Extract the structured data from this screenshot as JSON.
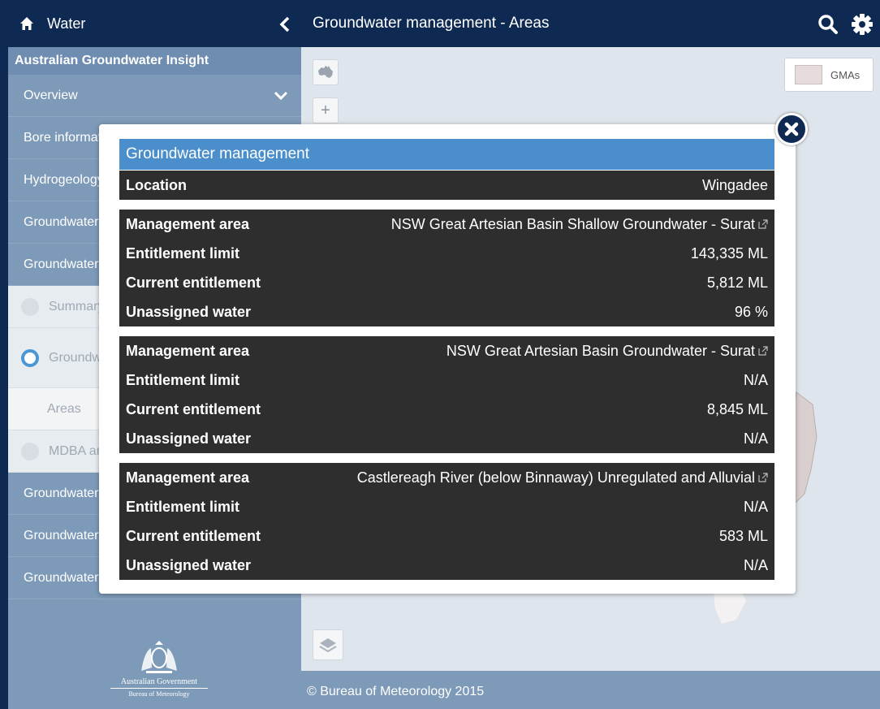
{
  "sidebar": {
    "header": "Water",
    "app_title": "Australian Groundwater Insight",
    "items": [
      {
        "label": "Overview"
      },
      {
        "label": "Bore information"
      },
      {
        "label": "Hydrogeology"
      },
      {
        "label": "Groundwater levels"
      },
      {
        "label": "Groundwater management"
      }
    ],
    "sub_items": [
      {
        "label": "Summary"
      },
      {
        "label": "Groundwater management areas"
      },
      {
        "label": "Areas"
      },
      {
        "label": "MDBA areas"
      }
    ],
    "items_after": [
      {
        "label": "Groundwater"
      },
      {
        "label": "Groundwater"
      },
      {
        "label": "Groundwater"
      }
    ],
    "logo": {
      "gov": "Australian Government",
      "bom": "Bureau of Meteorology"
    }
  },
  "topbar": {
    "title": "Groundwater management - Areas"
  },
  "map": {
    "legend_label": "GMAs",
    "zoom_in": "+"
  },
  "footer": {
    "text": "© Bureau of Meteorology 2015"
  },
  "popup": {
    "title": "Groundwater management",
    "location_label": "Location",
    "location_value": "Wingadee",
    "areas": [
      {
        "management_area_label": "Management area",
        "management_area": "NSW Great Artesian Basin Shallow Groundwater - Surat",
        "entitlement_limit_label": "Entitlement limit",
        "entitlement_limit": "143,335 ML",
        "current_entitlement_label": "Current entitlement",
        "current_entitlement": "5,812 ML",
        "unassigned_label": "Unassigned water",
        "unassigned": "96 %"
      },
      {
        "management_area_label": "Management area",
        "management_area": "NSW Great Artesian Basin Groundwater - Surat",
        "entitlement_limit_label": "Entitlement limit",
        "entitlement_limit": "N/A",
        "current_entitlement_label": "Current entitlement",
        "current_entitlement": "8,845 ML",
        "unassigned_label": "Unassigned water",
        "unassigned": "N/A"
      },
      {
        "management_area_label": "Management area",
        "management_area": "Castlereagh River (below Binnaway) Unregulated and Alluvial",
        "entitlement_limit_label": "Entitlement limit",
        "entitlement_limit": "N/A",
        "current_entitlement_label": "Current entitlement",
        "current_entitlement": "583 ML",
        "unassigned_label": "Unassigned water",
        "unassigned": "N/A"
      }
    ]
  }
}
